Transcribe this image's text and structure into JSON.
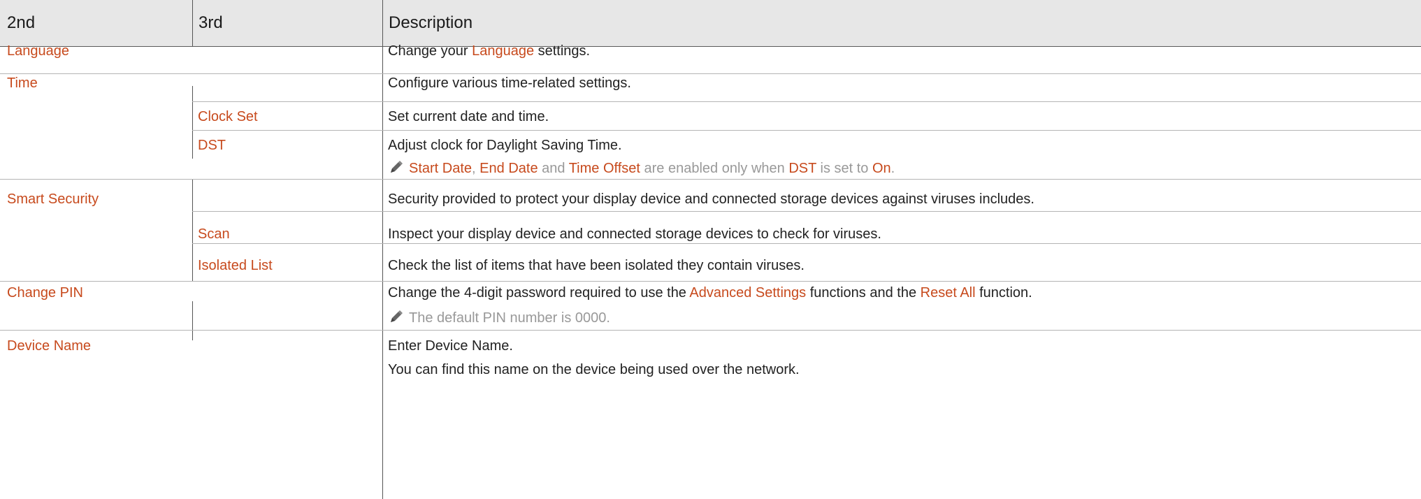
{
  "header": {
    "col1": "2nd",
    "col2": "3rd",
    "col3": "Description"
  },
  "language": {
    "label": "Language",
    "desc_pre": "Change your ",
    "desc_link": "Language",
    "desc_post": " settings."
  },
  "time": {
    "label": "Time",
    "desc": "Configure various time-related settings.",
    "clock_set": {
      "label": "Clock Set",
      "desc": "Set current date and time."
    },
    "dst": {
      "label": "DST",
      "desc": "Adjust clock for Daylight Saving Time.",
      "note": {
        "icon": "pencil-note-icon",
        "link1": "Start Date",
        "sep1": ", ",
        "link2": "End Date",
        "and": " and ",
        "link3": "Time Offset",
        "mid": " are enabled only when ",
        "link4": "DST",
        "is_set_to": " is set to ",
        "link5": "On",
        "end": "."
      }
    }
  },
  "smart_security": {
    "label": "Smart Security",
    "desc": "Security provided to protect your display device and connected storage devices against viruses includes.",
    "scan": {
      "label": "Scan",
      "desc": "Inspect your display device and connected storage devices to check for viruses."
    },
    "isolated_list": {
      "label": "Isolated List",
      "desc": "Check the list of items that have been isolated they contain viruses."
    }
  },
  "change_pin": {
    "label": "Change PIN",
    "desc_pre": "Change the 4-digit password required to use the ",
    "desc_link1": "Advanced Settings",
    "desc_mid": " functions and the ",
    "desc_link2": "Reset All",
    "desc_post": " function.",
    "note": {
      "icon": "pencil-note-icon",
      "text": "The default PIN number is 0000."
    }
  },
  "device_name": {
    "label": "Device Name",
    "desc1": "Enter Device Name.",
    "desc2": "You can find this name on the device being used over the network."
  },
  "colors": {
    "accent": "#c74a1d",
    "note_text": "#999999",
    "header_bg": "#e7e7e7"
  }
}
